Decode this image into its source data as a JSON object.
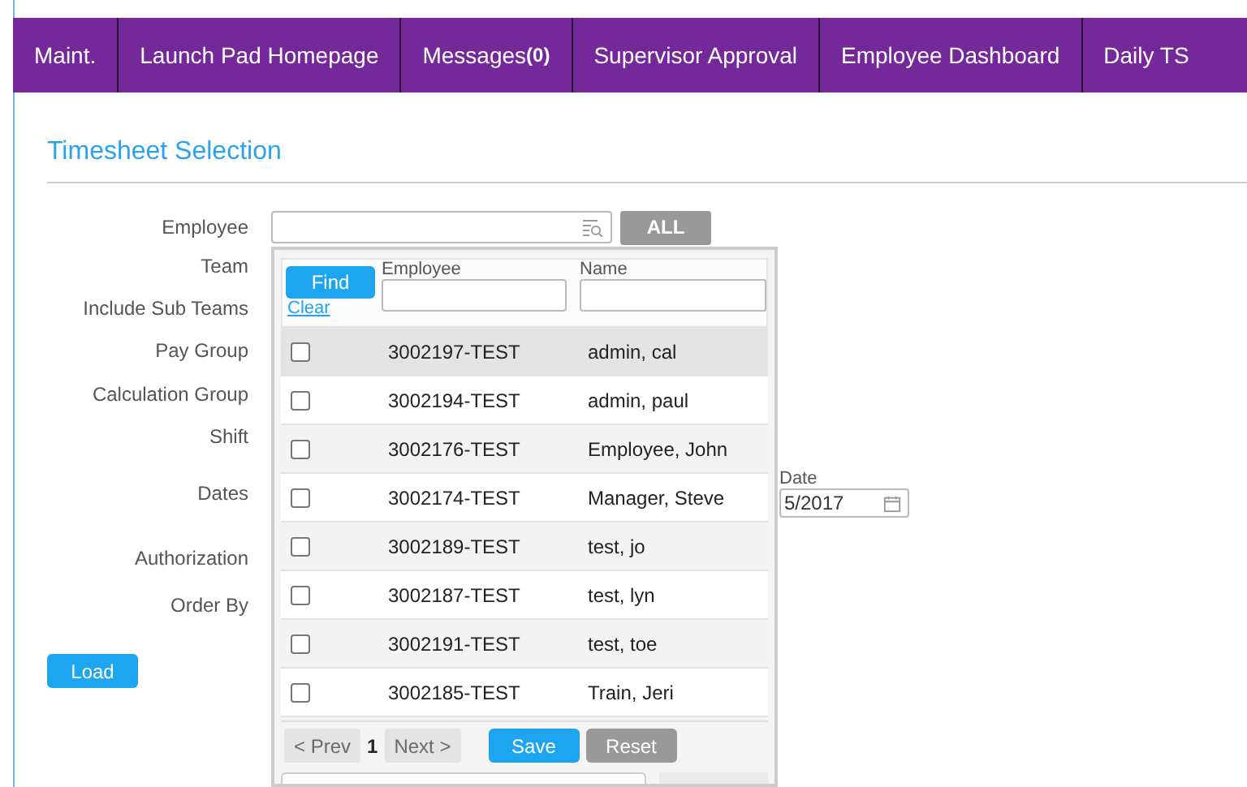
{
  "nav": {
    "tabs": [
      {
        "label": "Maint."
      },
      {
        "label": "Launch Pad Homepage"
      },
      {
        "label": "Messages**(0)**"
      },
      {
        "label": "Supervisor Approval"
      },
      {
        "label": "Employee Dashboard"
      },
      {
        "label": "Daily TS"
      }
    ]
  },
  "section_title": "Timesheet Selection",
  "form": {
    "labels": [
      "Employee",
      "Team",
      "Include Sub Teams",
      "Pay Group",
      "Calculation Group",
      "Shift",
      "Dates",
      "Authorization",
      "Order By"
    ],
    "all_button": "ALL",
    "date_label": "Date",
    "date_value": "5/2017",
    "load_button": "Load"
  },
  "picker": {
    "find_button": "Find",
    "clear_link": "Clear",
    "columns": [
      "Employee",
      "Name"
    ],
    "rows": [
      {
        "id": "3002197-TEST",
        "name": "admin, cal",
        "checked": false,
        "highlighted": true
      },
      {
        "id": "3002194-TEST",
        "name": "admin, paul",
        "checked": false,
        "highlighted": false
      },
      {
        "id": "3002176-TEST",
        "name": "Employee, John",
        "checked": false,
        "highlighted": false
      },
      {
        "id": "3002174-TEST",
        "name": "Manager, Steve",
        "checked": false,
        "highlighted": false
      },
      {
        "id": "3002189-TEST",
        "name": "test, jo",
        "checked": false,
        "highlighted": false
      },
      {
        "id": "3002187-TEST",
        "name": "test, lyn",
        "checked": false,
        "highlighted": false
      },
      {
        "id": "3002191-TEST",
        "name": "test, toe",
        "checked": false,
        "highlighted": false
      },
      {
        "id": "3002185-TEST",
        "name": "Train, Jeri",
        "checked": false,
        "highlighted": false
      }
    ],
    "prev": {
      "label": "< Prev",
      "disabled": true
    },
    "page": "1",
    "next": {
      "label": "Next >",
      "disabled": true
    },
    "save_button": "Save",
    "reset_button": "Reset"
  }
}
